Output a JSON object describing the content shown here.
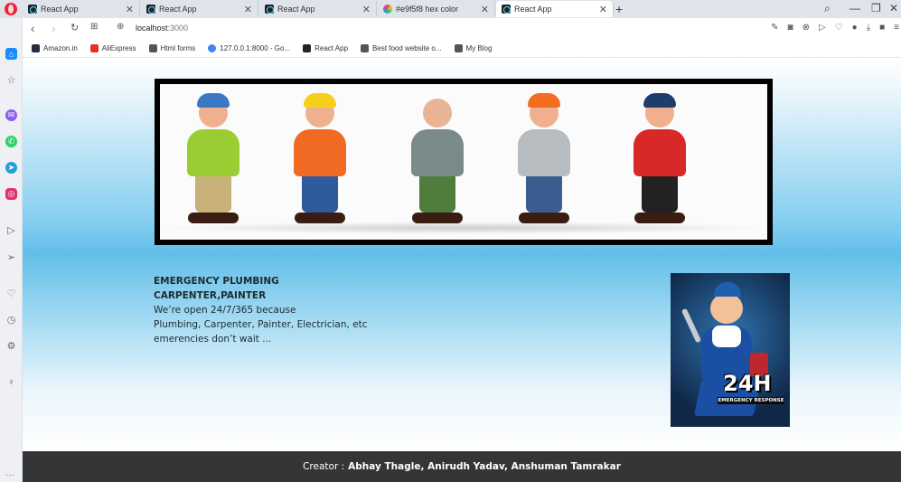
{
  "browser": {
    "tabs": [
      {
        "title": "React App",
        "favicon": "react-icon"
      },
      {
        "title": "React App",
        "favicon": "react-icon"
      },
      {
        "title": "React App",
        "favicon": "react-icon"
      },
      {
        "title": "#e9f5f8 hex color",
        "favicon": "color-wheel-icon"
      },
      {
        "title": "React App",
        "favicon": "react-icon",
        "active": true
      }
    ],
    "url_host": "localhost",
    "url_port": ":3000",
    "bookmarks": [
      {
        "label": "Amazon.in",
        "icon": "amazon-icon",
        "color": "#232f3e"
      },
      {
        "label": "AliExpress",
        "icon": "aliexpress-icon",
        "color": "#e43225"
      },
      {
        "label": "Html forms",
        "icon": "page-icon",
        "color": "#555555"
      },
      {
        "label": "127.0.0.1:8000 - Go...",
        "icon": "google-icon",
        "color": "#4285f4"
      },
      {
        "label": "React App",
        "icon": "react-icon",
        "color": "#20232a"
      },
      {
        "label": "Best food website o...",
        "icon": "page-icon",
        "color": "#555555"
      },
      {
        "label": "My Blog",
        "icon": "page-icon",
        "color": "#555555"
      }
    ]
  },
  "content": {
    "title_line1": "EMERGENCY PLUMBING",
    "title_line2": "CARPENTER,PAINTER",
    "body_line1": "We’re open 24/7/365 because",
    "body_line2": "Plumbing, Carpenter, Painter, Electrician, etc",
    "body_line3": "emerencies don’t wait ...",
    "badge_big": "24H",
    "badge_sub": "EMERGENCY RESPONSE"
  },
  "footer": {
    "prefix": "Creator :",
    "names": "Abhay Thagle, Anirudh Yadav, Anshuman Tamrakar"
  },
  "colors": {
    "footer_bg": "#333537",
    "gradient_mid": "#62bee9",
    "opera_red": "#ff1b2d"
  }
}
